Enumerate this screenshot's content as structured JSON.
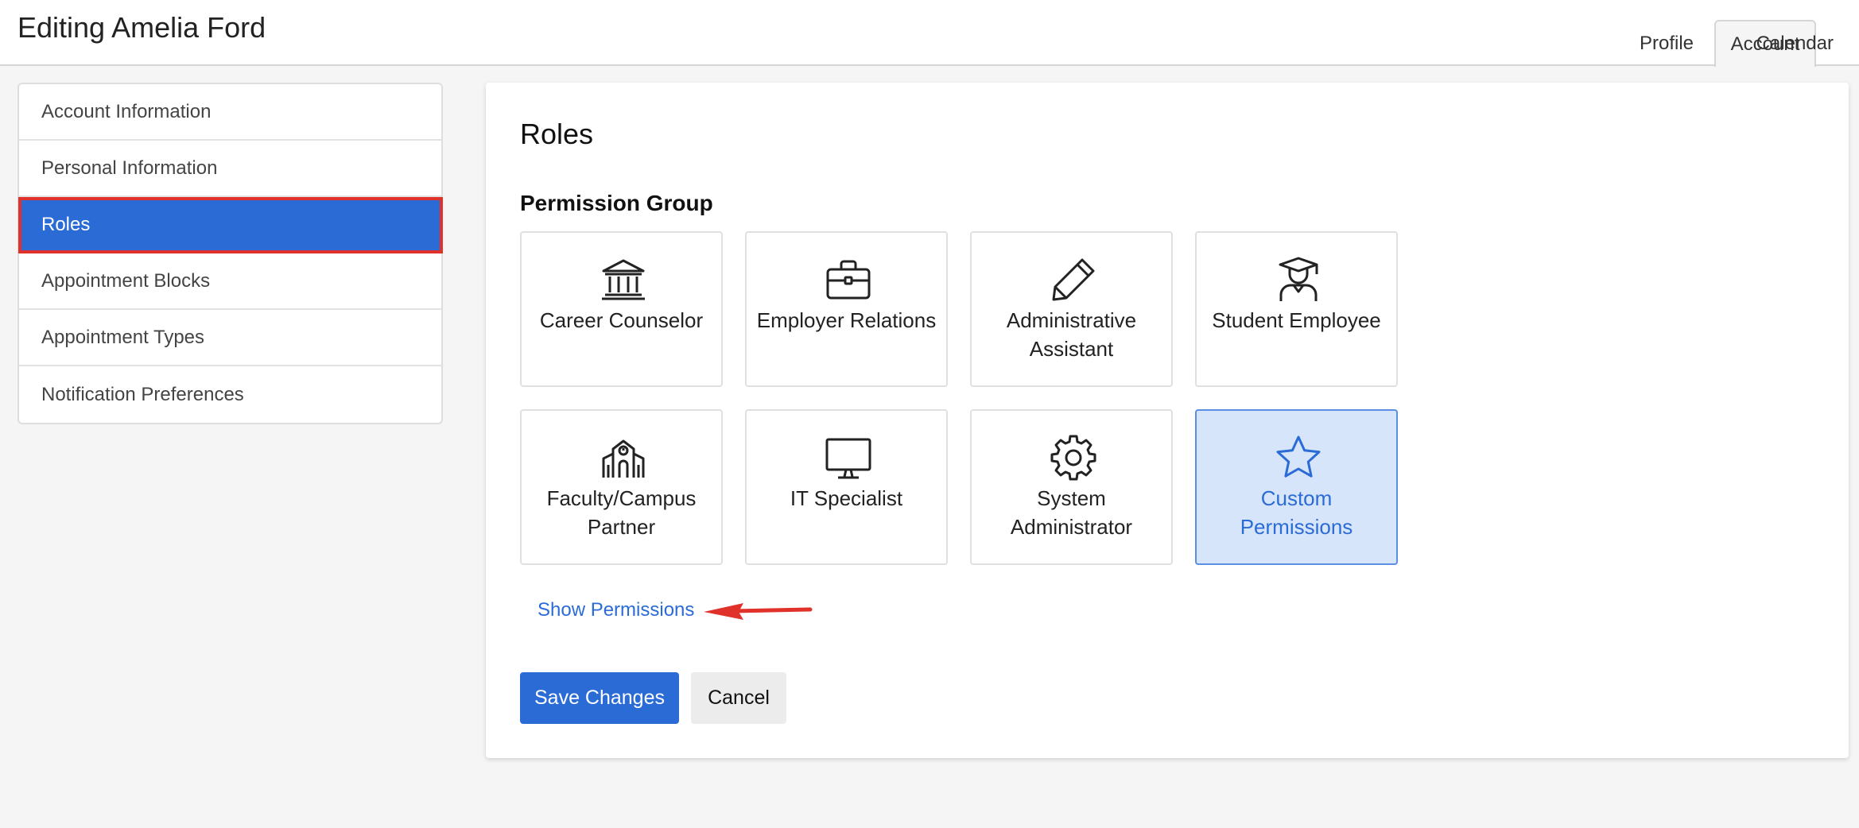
{
  "header": {
    "title": "Editing Amelia Ford",
    "tabs": [
      {
        "label": "Profile"
      },
      {
        "label": "Account",
        "active": true
      },
      {
        "label": "Calendar"
      }
    ]
  },
  "sidebar": {
    "items": [
      {
        "label": "Account Information"
      },
      {
        "label": "Personal Information"
      },
      {
        "label": "Roles",
        "active": true
      },
      {
        "label": "Appointment Blocks"
      },
      {
        "label": "Appointment Types"
      },
      {
        "label": "Notification Preferences"
      }
    ]
  },
  "main": {
    "title": "Roles",
    "group_title": "Permission Group",
    "tiles": [
      {
        "label": "Career Counselor",
        "icon": "bank-icon"
      },
      {
        "label": "Employer Relations",
        "icon": "briefcase-icon"
      },
      {
        "label": "Administrative Assistant",
        "icon": "pencil-icon"
      },
      {
        "label": "Student Employee",
        "icon": "graduate-icon"
      },
      {
        "label": "Faculty/Campus Partner",
        "icon": "school-building-icon"
      },
      {
        "label": "IT Specialist",
        "icon": "monitor-icon"
      },
      {
        "label": "System Administrator",
        "icon": "gear-icon"
      },
      {
        "label": "Custom Permissions",
        "icon": "star-icon",
        "selected": true
      }
    ],
    "show_permissions": "Show Permissions",
    "save_label": "Save Changes",
    "cancel_label": "Cancel"
  },
  "colors": {
    "accent": "#2a6bd6",
    "selected_tile_bg": "#d7e5fb",
    "highlight_outline": "#e0312a",
    "annotation_arrow": "#e0312a"
  }
}
